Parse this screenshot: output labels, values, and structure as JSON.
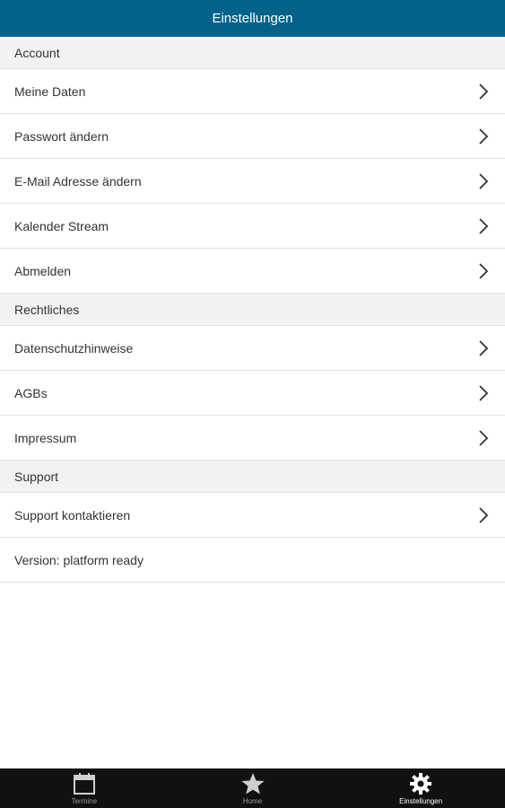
{
  "header": {
    "title": "Einstellungen"
  },
  "sections": {
    "account": {
      "title": "Account",
      "items": [
        {
          "label": "Meine Daten"
        },
        {
          "label": "Passwort ändern"
        },
        {
          "label": "E-Mail Adresse ändern"
        },
        {
          "label": "Kalender Stream"
        },
        {
          "label": "Abmelden"
        }
      ]
    },
    "legal": {
      "title": "Rechtliches",
      "items": [
        {
          "label": "Datenschutzhinweise"
        },
        {
          "label": "AGBs"
        },
        {
          "label": "Impressum"
        }
      ]
    },
    "support": {
      "title": "Support",
      "items": [
        {
          "label": "Support kontaktieren"
        }
      ],
      "version": "Version: platform ready"
    }
  },
  "tabbar": {
    "tabs": [
      {
        "label": "Termine",
        "icon": "calendar-icon"
      },
      {
        "label": "Home",
        "icon": "star-icon"
      },
      {
        "label": "Einstellungen",
        "icon": "gear-icon",
        "active": true
      }
    ]
  },
  "colors": {
    "header_bg": "#03628a",
    "tabbar_bg": "#111111"
  }
}
